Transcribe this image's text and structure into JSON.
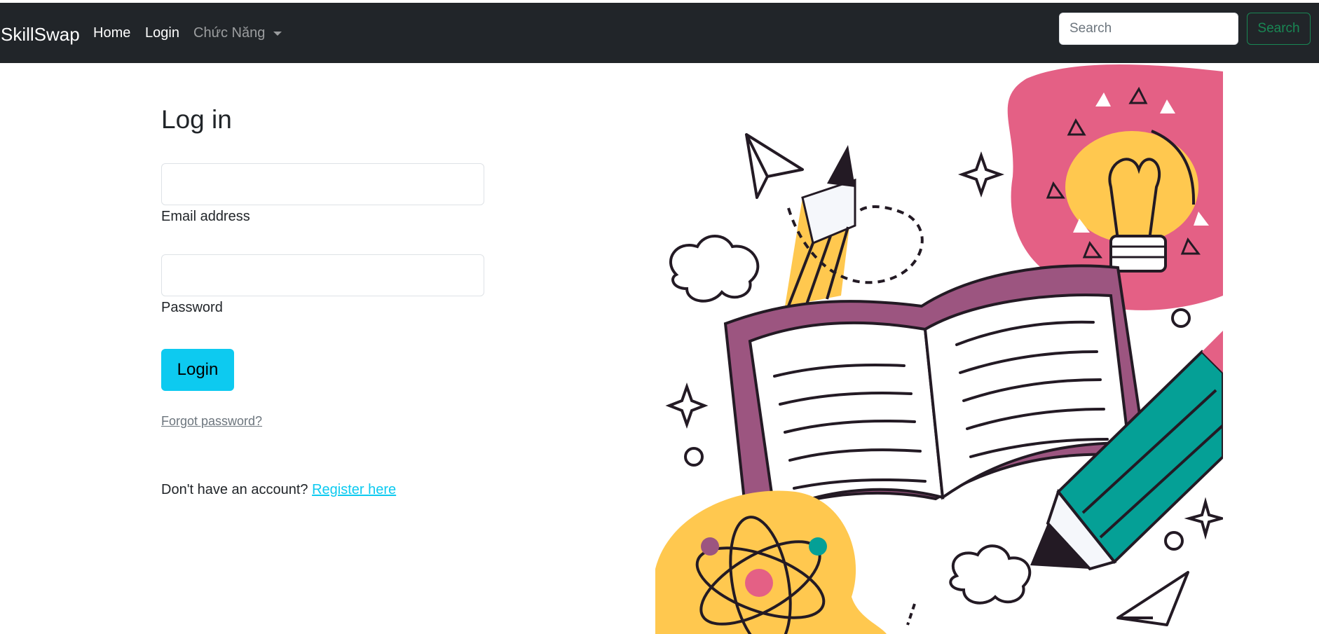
{
  "navbar": {
    "brand": "SkillSwap",
    "links": [
      {
        "label": "Home"
      },
      {
        "label": "Login"
      }
    ],
    "dropdown_label": "Chức Năng",
    "search": {
      "placeholder": "Search",
      "button_label": "Search"
    }
  },
  "login_form": {
    "title": "Log in",
    "email_label": "Email address",
    "password_label": "Password",
    "submit_label": "Login",
    "forgot_link": "Forgot password?",
    "register_prompt": "Don't have an account?",
    "register_link": "Register here"
  },
  "colors": {
    "navbar_bg": "#212529",
    "accent_info": "#0dcaf0",
    "search_success": "#198754",
    "muted": "#6c757d"
  },
  "icons": {
    "dropdown_caret": "chevron-down-icon",
    "illustration": "education-illustration"
  }
}
